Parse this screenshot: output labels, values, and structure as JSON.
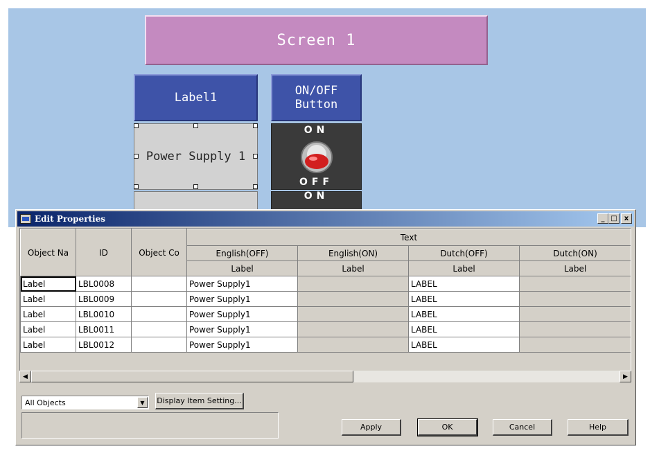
{
  "designer": {
    "screen_title": "Screen 1",
    "label_header": "Label1",
    "onoff_header_line1": "ON/OFF",
    "onoff_header_line2": "Button",
    "label_text": "Power Supply 1",
    "switch_on": "ON",
    "switch_off": "OFF",
    "switch_on_2": "ON"
  },
  "dialog": {
    "title": "Edit Properties",
    "minimize": "_",
    "maximize": "□",
    "close": "x"
  },
  "grid": {
    "col_object_name": "Object Na",
    "col_id": "ID",
    "col_object_comment": "Object Co",
    "group_text": "Text",
    "lang_english_off": "English(OFF)",
    "lang_english_on": "English(ON)",
    "lang_dutch_off": "Dutch(OFF)",
    "lang_dutch_on": "Dutch(ON)",
    "sub_label": "Label",
    "rows": [
      {
        "name": "Label",
        "id": "LBL0008",
        "comment": "",
        "en_off": "Power Supply1",
        "en_on": "",
        "nl_off": "LABEL",
        "nl_on": ""
      },
      {
        "name": "Label",
        "id": "LBL0009",
        "comment": "",
        "en_off": "Power Supply1",
        "en_on": "",
        "nl_off": "LABEL",
        "nl_on": ""
      },
      {
        "name": "Label",
        "id": "LBL0010",
        "comment": "",
        "en_off": "Power Supply1",
        "en_on": "",
        "nl_off": "LABEL",
        "nl_on": ""
      },
      {
        "name": "Label",
        "id": "LBL0011",
        "comment": "",
        "en_off": "Power Supply1",
        "en_on": "",
        "nl_off": "LABEL",
        "nl_on": ""
      },
      {
        "name": "Label",
        "id": "LBL0012",
        "comment": "",
        "en_off": "Power Supply1",
        "en_on": "",
        "nl_off": "LABEL",
        "nl_on": ""
      }
    ]
  },
  "footer": {
    "filter_value": "All Objects",
    "display_item_setting": "Display Item Setting...",
    "apply": "Apply",
    "ok": "OK",
    "cancel": "Cancel",
    "help": "Help"
  },
  "colors": {
    "canvas": "#a8c6e6",
    "screen_title_bg": "#c48ac0",
    "header_blue": "#3e53a8",
    "dialog_face": "#d4d0c8",
    "titlebar_start": "#0a246a"
  }
}
